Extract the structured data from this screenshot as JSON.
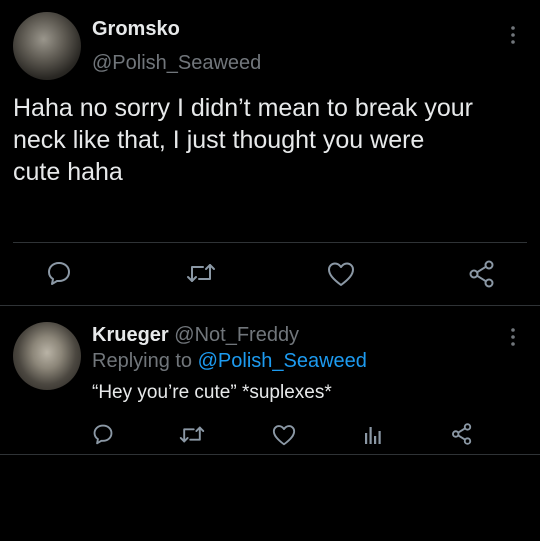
{
  "tweet": {
    "display_name": "Gromsko",
    "handle": "@Polish_Seaweed",
    "text_lines": [
      "Haha no sorry I didn’t mean to break your",
      "neck like that, I just thought you were",
      "cute haha"
    ],
    "actions": [
      "reply-icon",
      "retweet-icon",
      "like-icon",
      "share-icon"
    ]
  },
  "reply": {
    "display_name": "Krueger",
    "handle": "@Not_Freddy",
    "replying_prefix": "Replying to",
    "replying_to": "@Polish_Seaweed",
    "text": "“Hey you’re cute” *suplexes*",
    "actions": [
      "reply-icon",
      "retweet-icon",
      "like-icon",
      "analytics-icon",
      "share-icon"
    ]
  },
  "colors": {
    "background": "#000000",
    "text": "#e7e9ea",
    "secondary": "#71767b",
    "link": "#1d9bf0",
    "divider": "#2f3336"
  }
}
